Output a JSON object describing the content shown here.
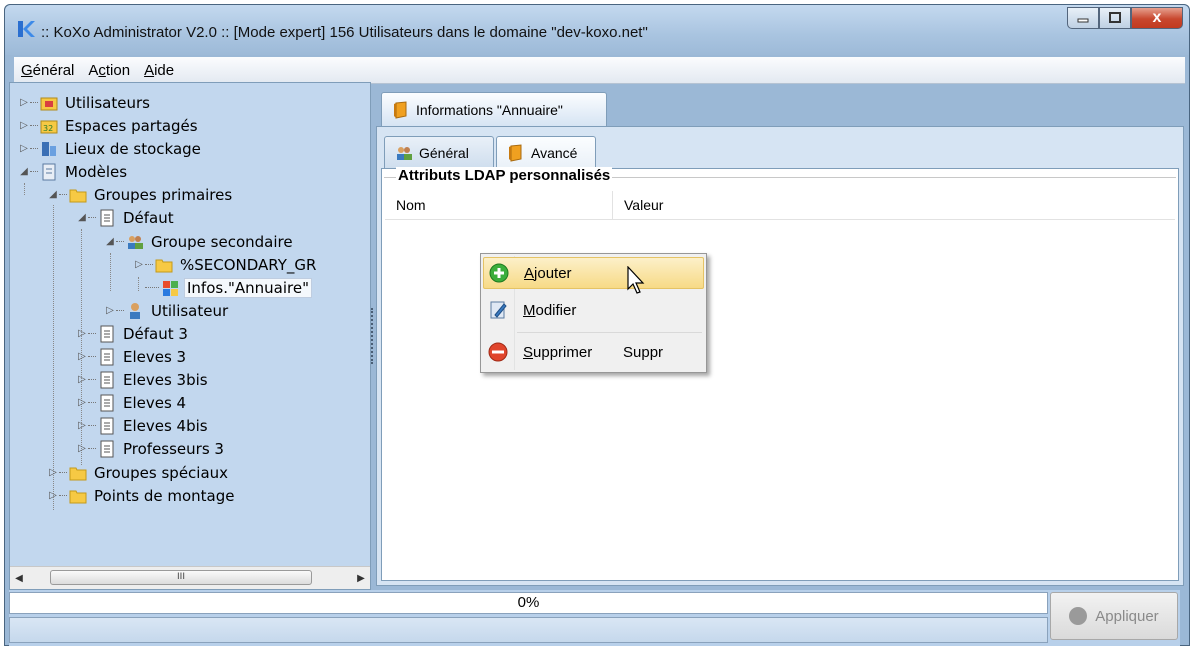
{
  "window": {
    "title": ":: KoXo Administrator V2.0 :: [Mode expert] 156 Utilisateurs dans le domaine \"dev-koxo.net\"",
    "close_glyph": "x"
  },
  "menubar": {
    "items": [
      {
        "first": "G",
        "rest": "énéral"
      },
      {
        "first": "A",
        "mid": "c",
        "rest": "tion"
      },
      {
        "first": "A",
        "rest": "ide"
      }
    ]
  },
  "tree": {
    "items": [
      {
        "label": "Utilisateurs",
        "icon": "users-folder-icon"
      },
      {
        "label": "Espaces partagés",
        "icon": "shared-space-icon"
      },
      {
        "label": "Lieux de stockage",
        "icon": "storage-icon"
      },
      {
        "label": "Modèles",
        "icon": "model-icon"
      },
      {
        "label": "Groupes primaires",
        "icon": "folder-icon"
      },
      {
        "label": "Défaut",
        "icon": "document-icon"
      },
      {
        "label": "Groupe secondaire",
        "icon": "group-icon"
      },
      {
        "label": "%SECONDARY_GR",
        "icon": "folder-icon"
      },
      {
        "label": "Infos.\"Annuaire\"",
        "icon": "directory-info-icon"
      },
      {
        "label": "Utilisateur",
        "icon": "user-icon"
      },
      {
        "label": "Défaut 3",
        "icon": "document-icon"
      },
      {
        "label": "Eleves 3",
        "icon": "document-icon"
      },
      {
        "label": "Eleves 3bis",
        "icon": "document-icon"
      },
      {
        "label": "Eleves 4",
        "icon": "document-icon"
      },
      {
        "label": "Eleves 4bis",
        "icon": "document-icon"
      },
      {
        "label": "Professeurs 3",
        "icon": "document-icon"
      },
      {
        "label": "Groupes spéciaux",
        "icon": "folder-icon"
      },
      {
        "label": "Points de montage",
        "icon": "folder-icon"
      }
    ],
    "scroll_thumb": "III"
  },
  "panel": {
    "outer_tab": "Informations \"Annuaire\"",
    "inner_tabs": [
      "Général",
      "Avancé"
    ],
    "group_title": "Attributs LDAP personnalisés",
    "columns": [
      "Nom",
      "Valeur"
    ]
  },
  "context_menu": {
    "items": [
      {
        "first": "A",
        "rest": "jouter",
        "shortcut": "",
        "icon": "add-icon"
      },
      {
        "first": "M",
        "rest": "odifier",
        "shortcut": "",
        "icon": "edit-icon"
      },
      {
        "first": "S",
        "rest": "upprimer",
        "shortcut": "Suppr",
        "icon": "delete-icon"
      }
    ]
  },
  "status": {
    "progress": "0%",
    "apply_label": "Appliquer"
  }
}
